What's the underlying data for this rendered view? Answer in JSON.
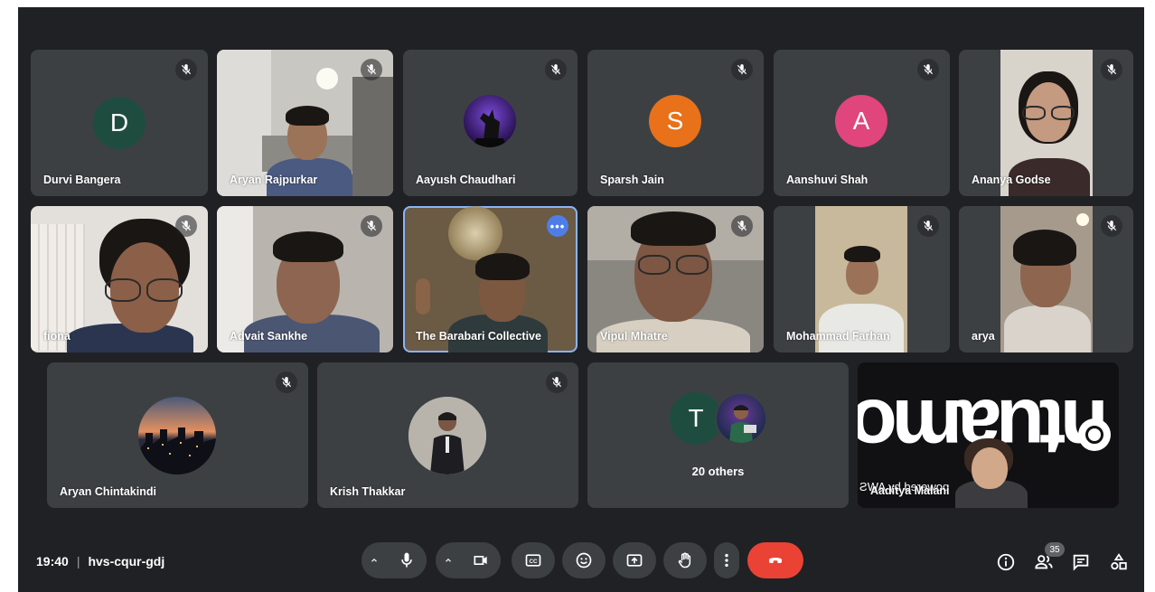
{
  "participants_row1": [
    {
      "name": "Durvi Bangera",
      "initial": "D",
      "avatar_color": "#1e4d3f"
    },
    {
      "name": "Aryan Rajpurkar"
    },
    {
      "name": "Aayush Chaudhari"
    },
    {
      "name": "Sparsh Jain",
      "initial": "S",
      "avatar_color": "#e8711a"
    },
    {
      "name": "Aanshuvi Shah",
      "initial": "A",
      "avatar_color": "#e0457b"
    },
    {
      "name": "Ananya Godse"
    }
  ],
  "participants_row2": [
    {
      "name": "fiona"
    },
    {
      "name": "Advait Sankhe"
    },
    {
      "name": "The Barabari Collective",
      "more_label": "•••"
    },
    {
      "name": "Vipul Mhatre"
    },
    {
      "name": "Mohammad Farhan"
    },
    {
      "name": "arya"
    }
  ],
  "participants_row3": [
    {
      "name": "Aryan Chintakindi"
    },
    {
      "name": "Krish Thakkar"
    },
    {
      "name": "20 others",
      "initial": "T",
      "avatar_color": "#1e4d3f"
    },
    {
      "name": "Aaditya Malani",
      "background_text": "ntuamo",
      "caption": "powered by AWS"
    }
  ],
  "meeting": {
    "time": "19:40",
    "separator": "|",
    "code": "hvs-cqur-gdj"
  },
  "participant_count": "35",
  "controls": {
    "mic": "microphone-icon",
    "camera": "camera-icon",
    "captions": "captions-icon",
    "emoji": "emoji-icon",
    "present": "present-icon",
    "raise_hand": "raise-hand-icon",
    "more": "more-options-icon",
    "end_call": "end-call-icon"
  },
  "right_controls": [
    "info-icon",
    "people-icon",
    "chat-icon",
    "activities-icon"
  ],
  "colors": {
    "background": "#202124",
    "tile": "#3c4043",
    "end_call": "#ea4335",
    "active_border": "#8ab4f8"
  }
}
